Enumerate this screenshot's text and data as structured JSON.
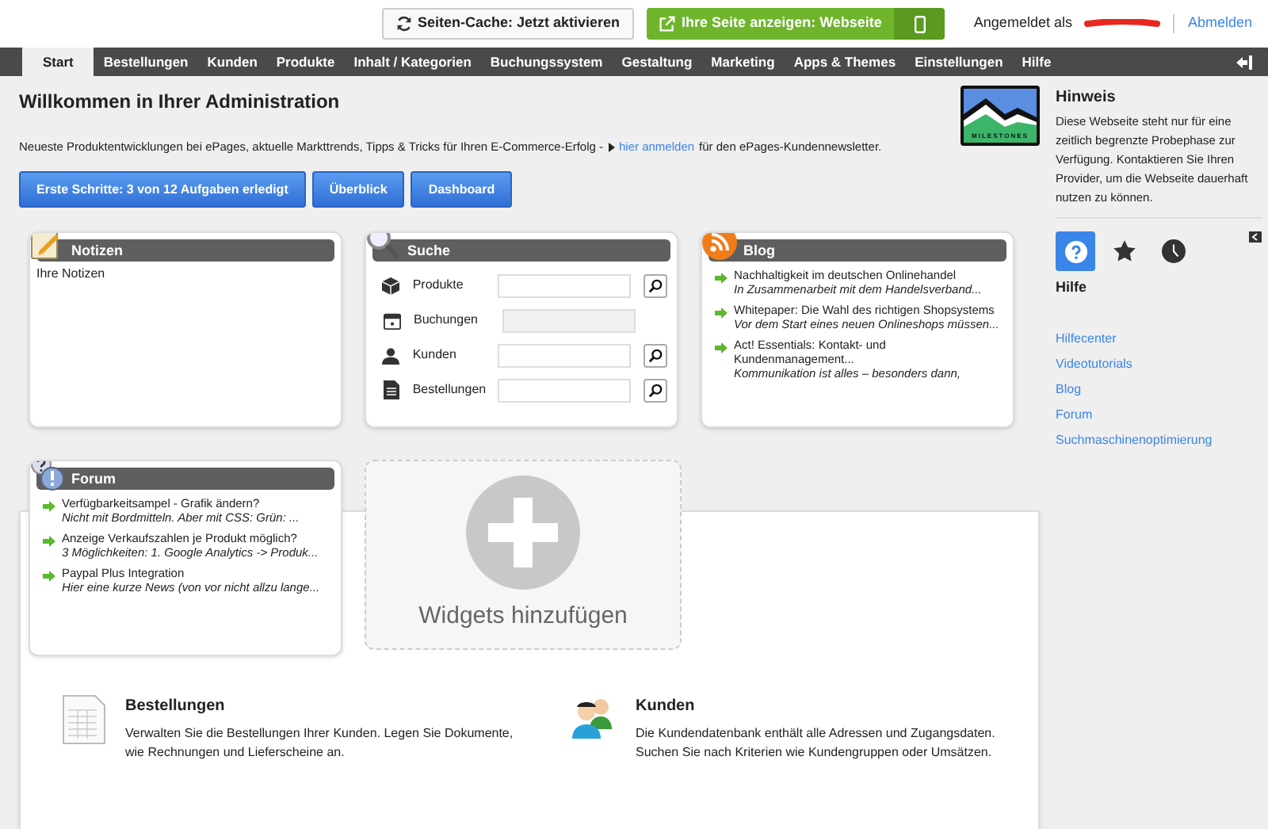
{
  "top_bar": {
    "cache_button": "Seiten-Cache: Jetzt aktivieren",
    "view_button": "Ihre Seite anzeigen: Webseite",
    "logged_in_label": "Angemeldet als",
    "logout_link": "Abmelden"
  },
  "nav": [
    {
      "label": "Start",
      "selected": true
    },
    {
      "label": "Bestellungen",
      "selected": false
    },
    {
      "label": "Kunden",
      "selected": false
    },
    {
      "label": "Produkte",
      "selected": false
    },
    {
      "label": "Inhalt / Kategorien",
      "selected": false
    },
    {
      "label": "Buchungssystem",
      "selected": false
    },
    {
      "label": "Gestaltung",
      "selected": false
    },
    {
      "label": "Marketing",
      "selected": false
    },
    {
      "label": "Apps & Themes",
      "selected": false
    },
    {
      "label": "Einstellungen",
      "selected": false
    },
    {
      "label": "Hilfe",
      "selected": false
    }
  ],
  "page_title": "Willkommen in Ihrer Administration",
  "newsletter": {
    "before": "Neueste Produktentwicklungen bei ePages, aktuelle Markttrends, Tipps & Tricks für Ihren E-Commerce-Erfolg -",
    "link": "hier anmelden",
    "after": "für den ePages-Kundennewsletter."
  },
  "buttons": [
    "Erste Schritte: 3 von 12 Aufgaben erledigt",
    "Überblick",
    "Dashboard"
  ],
  "notes": {
    "title": "Notizen",
    "text": "Ihre Notizen"
  },
  "search": {
    "title": "Suche",
    "rows": [
      {
        "kind": "box",
        "label": "Produkte",
        "disabled": false
      },
      {
        "kind": "calendar",
        "label": "Buchungen",
        "disabled": true
      },
      {
        "kind": "person",
        "label": "Kunden",
        "disabled": false
      },
      {
        "kind": "document",
        "label": "Bestellungen",
        "disabled": false
      }
    ]
  },
  "blog": {
    "title": "Blog",
    "items": [
      {
        "title": "Nachhaltigkeit im deutschen Onlinehandel",
        "teaser": "In Zusammenarbeit mit dem Handelsverband..."
      },
      {
        "title": "Whitepaper: Die Wahl des richtigen Shopsystems",
        "teaser": "Vor dem Start eines neuen Onlineshops müssen..."
      },
      {
        "title": "Act! Essentials: Kontakt- und Kundenmanagement...",
        "teaser": "Kommunikation ist alles – besonders dann,"
      }
    ]
  },
  "forum": {
    "title": "Forum",
    "items": [
      {
        "title": "Verfügbarkeitsampel - Grafik ändern?",
        "teaser": "Nicht mit Bordmitteln. Aber mit CSS: Grün: ..."
      },
      {
        "title": "Anzeige Verkaufszahlen je Produkt möglich?",
        "teaser": "3 Möglichkeiten: 1. Google Analytics -> Produk..."
      },
      {
        "title": "Paypal Plus Integration",
        "teaser": "Hier eine kurze News (von vor nicht allzu lange..."
      }
    ]
  },
  "add_widget": "Widgets hinzufügen",
  "info_cards": [
    {
      "kind": "orders",
      "title": "Bestellungen",
      "text": "Verwalten Sie die Bestellungen Ihrer Kunden. Legen Sie Dokumente, wie Rechnungen und Lieferscheine an."
    },
    {
      "kind": "customers",
      "title": "Kunden",
      "text": "Die Kundendatenbank enthält alle Adressen und Zugangsdaten. Suchen Sie nach Kriterien wie Kundengruppen oder Umsätzen."
    }
  ],
  "sidebar": {
    "logo_text": "MILESTONES",
    "notice_title": "Hinweis",
    "notice_text": "Diese Webseite steht nur für eine zeitlich begrenzte Probephase zur Verfügung. Kontaktieren Sie Ihren Provider, um die Webseite dauerhaft nutzen zu können.",
    "tabs": [
      {
        "kind": "help",
        "selected": true
      },
      {
        "kind": "star",
        "selected": false
      },
      {
        "kind": "clock",
        "selected": false
      }
    ],
    "section_title": "Hilfe",
    "links": [
      "Hilfecenter",
      "Videotutorials",
      "Blog",
      "Forum",
      "Suchmaschinenoptimierung"
    ]
  }
}
